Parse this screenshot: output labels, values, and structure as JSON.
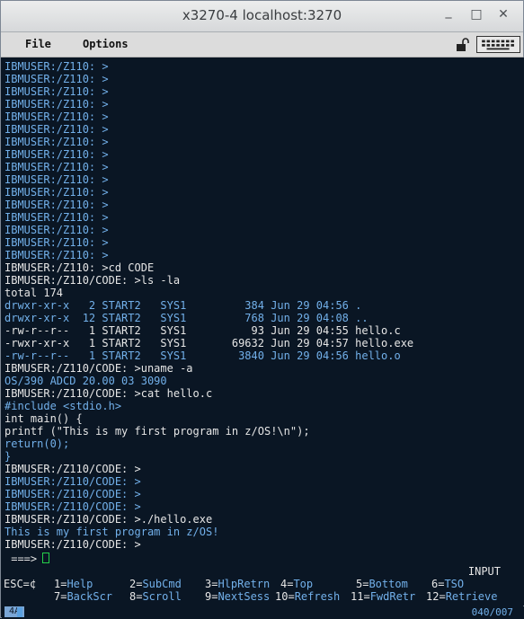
{
  "window": {
    "title": "x3270-4 localhost:3270"
  },
  "menu": {
    "file": "File",
    "options": "Options"
  },
  "terminal": {
    "lines": [
      {
        "text": "IBMUSER:/Z110: >",
        "c": "b"
      },
      {
        "text": "IBMUSER:/Z110: >",
        "c": "b"
      },
      {
        "text": "IBMUSER:/Z110: >",
        "c": "b"
      },
      {
        "text": "IBMUSER:/Z110: >",
        "c": "b"
      },
      {
        "text": "IBMUSER:/Z110: >",
        "c": "b"
      },
      {
        "text": "IBMUSER:/Z110: >",
        "c": "b"
      },
      {
        "text": "IBMUSER:/Z110: >",
        "c": "b"
      },
      {
        "text": "IBMUSER:/Z110: >",
        "c": "b"
      },
      {
        "text": "IBMUSER:/Z110: >",
        "c": "b"
      },
      {
        "text": "IBMUSER:/Z110: >",
        "c": "b"
      },
      {
        "text": "IBMUSER:/Z110: >",
        "c": "b"
      },
      {
        "text": "IBMUSER:/Z110: >",
        "c": "b"
      },
      {
        "text": "IBMUSER:/Z110: >",
        "c": "b"
      },
      {
        "text": "IBMUSER:/Z110: >",
        "c": "b"
      },
      {
        "text": "IBMUSER:/Z110: >",
        "c": "b"
      },
      {
        "text": "IBMUSER:/Z110: >",
        "c": "b"
      },
      {
        "text": "IBMUSER:/Z110: >cd CODE",
        "c": "w"
      },
      {
        "text": "IBMUSER:/Z110/CODE: >ls -la",
        "c": "w"
      },
      {
        "text": "total 174",
        "c": "w"
      },
      {
        "text": "drwxr-xr-x   2 START2   SYS1         384 Jun 29 04:56 .",
        "c": "b"
      },
      {
        "text": "drwxr-xr-x  12 START2   SYS1         768 Jun 29 04:08 ..",
        "c": "b"
      },
      {
        "text": "-rw-r--r--   1 START2   SYS1          93 Jun 29 04:55 hello.c",
        "c": "w"
      },
      {
        "text": "-rwxr-xr-x   1 START2   SYS1       69632 Jun 29 04:57 hello.exe",
        "c": "w"
      },
      {
        "text": "-rw-r--r--   1 START2   SYS1        3840 Jun 29 04:56 hello.o",
        "c": "b"
      },
      {
        "text": "IBMUSER:/Z110/CODE: >uname -a",
        "c": "w"
      },
      {
        "text": "OS/390 ADCD 20.00 03 3090",
        "c": "b"
      },
      {
        "text": "IBMUSER:/Z110/CODE: >cat hello.c",
        "c": "w"
      },
      {
        "text": "#include <stdio.h>",
        "c": "b"
      },
      {
        "text": "int main() {",
        "c": "w"
      },
      {
        "text": "printf (\"This is my first program in z/OS!\\n\");",
        "c": "w"
      },
      {
        "text": "return(0);",
        "c": "b"
      },
      {
        "text": "}",
        "c": "b"
      },
      {
        "text": "IBMUSER:/Z110/CODE: >",
        "c": "w"
      },
      {
        "text": "IBMUSER:/Z110/CODE: >",
        "c": "b"
      },
      {
        "text": "IBMUSER:/Z110/CODE: >",
        "c": "b"
      },
      {
        "text": "IBMUSER:/Z110/CODE: >",
        "c": "b"
      },
      {
        "text": "IBMUSER:/Z110/CODE: >./hello.exe",
        "c": "w"
      },
      {
        "text": "This is my first program in z/OS!",
        "c": "b"
      },
      {
        "text": "IBMUSER:/Z110/CODE: >",
        "c": "w"
      }
    ],
    "prompt": " ===>",
    "status": "INPUT"
  },
  "pfkeys": {
    "row1": [
      {
        "k": "ESC=¢",
        "v": ""
      },
      {
        "k": "1=",
        "v": "Help"
      },
      {
        "k": "2=",
        "v": "SubCmd"
      },
      {
        "k": "3=",
        "v": "HlpRetrn"
      },
      {
        "k": "4=",
        "v": "Top"
      },
      {
        "k": "5=",
        "v": "Bottom"
      },
      {
        "k": "6=",
        "v": "TSO"
      }
    ],
    "row2": [
      {
        "k": "7=",
        "v": "BackScr"
      },
      {
        "k": "8=",
        "v": "Scroll"
      },
      {
        "k": "9=",
        "v": "NextSess"
      },
      {
        "k": "10=",
        "v": "Refresh"
      },
      {
        "k": "11=",
        "v": "FwdRetr"
      },
      {
        "k": "12=",
        "v": "Retrieve"
      }
    ]
  },
  "oia": {
    "indicator": "4A",
    "cursor_pos": "040/007"
  }
}
